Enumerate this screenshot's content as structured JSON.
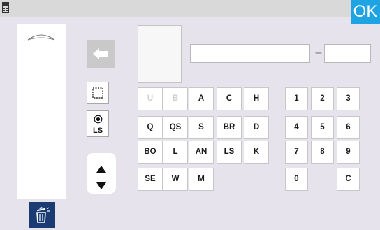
{
  "header": {
    "ok_label": "OK",
    "app_icon": "device-icon"
  },
  "left_panel": {
    "handle_icon": "handle-icon"
  },
  "tools": {
    "back_icon": "arrow-left-icon",
    "select_icon": "dashed-square-icon",
    "ls_label": "LS",
    "up_icon": "triangle-up-icon",
    "down_icon": "triangle-down-icon",
    "trash_icon": "trash-icon"
  },
  "letter_keys": [
    {
      "label": "U",
      "enabled": false
    },
    {
      "label": "B",
      "enabled": false
    },
    {
      "label": "A",
      "enabled": true
    },
    {
      "label": "C",
      "enabled": true
    },
    {
      "label": "H",
      "enabled": true
    },
    {
      "label": "Q",
      "enabled": true
    },
    {
      "label": "QS",
      "enabled": true
    },
    {
      "label": "S",
      "enabled": true
    },
    {
      "label": "BR",
      "enabled": true
    },
    {
      "label": "D",
      "enabled": true
    },
    {
      "label": "BO",
      "enabled": true
    },
    {
      "label": "L",
      "enabled": true
    },
    {
      "label": "AN",
      "enabled": true
    },
    {
      "label": "LS",
      "enabled": true
    },
    {
      "label": "K",
      "enabled": true
    },
    {
      "label": "SE",
      "enabled": true
    },
    {
      "label": "W",
      "enabled": true
    },
    {
      "label": "M",
      "enabled": true
    }
  ],
  "number_keys": [
    {
      "label": "1"
    },
    {
      "label": "2"
    },
    {
      "label": "3"
    },
    {
      "label": "4"
    },
    {
      "label": "5"
    },
    {
      "label": "6"
    },
    {
      "label": "7"
    },
    {
      "label": "8"
    },
    {
      "label": "9"
    },
    {
      "label": "0"
    },
    {
      "label": "C"
    }
  ],
  "colors": {
    "accent": "#1ea3e3",
    "trash_bg": "#1a3c72",
    "background": "#e6e3ec",
    "titlebar": "#d9d9d9"
  }
}
